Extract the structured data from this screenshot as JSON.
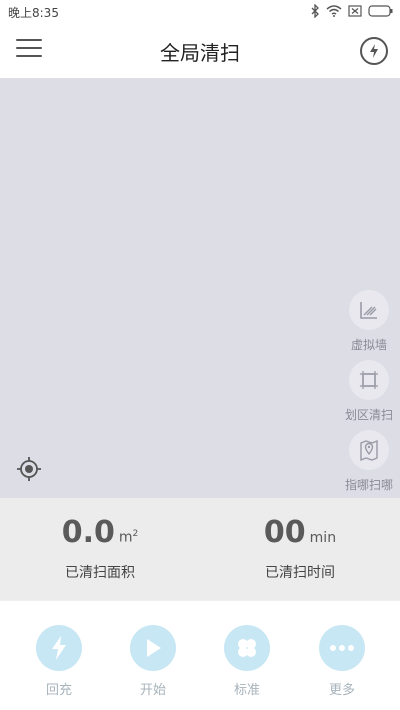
{
  "status_bar": {
    "time": "晚上8:35",
    "icons": [
      "bluetooth-icon",
      "wifi-icon",
      "sim-icon",
      "battery-icon"
    ]
  },
  "header": {
    "title": "全局清扫",
    "menu_icon": "hamburger-menu-icon",
    "action_icon": "lightning-icon"
  },
  "map_tools": [
    {
      "icon": "virtual-wall-icon",
      "label": "虚拟墙"
    },
    {
      "icon": "zone-clean-icon",
      "label": "划区清扫"
    },
    {
      "icon": "pin-clean-icon",
      "label": "指哪扫哪"
    }
  ],
  "locate_icon": "locate-icon",
  "stats": {
    "area": {
      "value": "0.0",
      "unit": "m",
      "unit_sup": "2",
      "label": "已清扫面积"
    },
    "time": {
      "value": "00",
      "unit": "min",
      "label": "已清扫时间"
    }
  },
  "bottom_actions": [
    {
      "icon": "lightning-icon",
      "label": "回充"
    },
    {
      "icon": "play-icon",
      "label": "开始"
    },
    {
      "icon": "fan-icon",
      "label": "标准"
    },
    {
      "icon": "more-icon",
      "label": "更多"
    }
  ],
  "colors": {
    "map_bg": "#dcdde5",
    "stats_bg": "#ececec",
    "action_circle": "#c6e7f3"
  }
}
